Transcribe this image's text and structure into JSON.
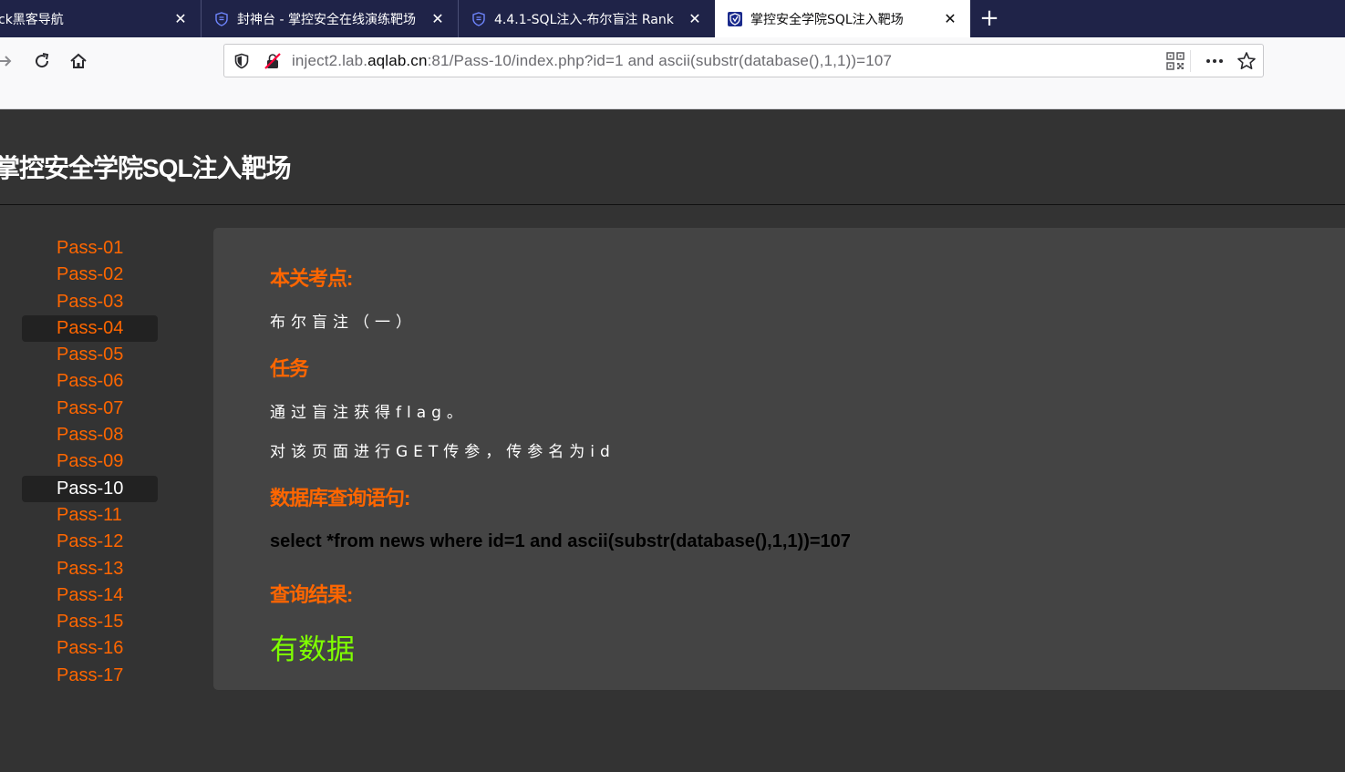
{
  "browser": {
    "tabs": [
      {
        "title": "ck黑客导航",
        "active": false
      },
      {
        "title": "封神台 - 掌控安全在线演练靶场",
        "active": false
      },
      {
        "title": "4.4.1-SQL注入-布尔盲注 Rank",
        "active": false
      },
      {
        "title": "掌控安全学院SQL注入靶场",
        "active": true
      }
    ],
    "url": {
      "prefix": "inject2.lab.",
      "domain": "aqlab.cn",
      "path": ":81/Pass-10/index.php?id=1 and ascii(substr(database(),1,1))=107"
    },
    "colors": {
      "tabbar": "#1f2348",
      "accent": "#ff6600"
    }
  },
  "site": {
    "title": "掌控安全学院SQL注入靶场"
  },
  "sidebar": {
    "items": [
      {
        "label": "Pass-01"
      },
      {
        "label": "Pass-02"
      },
      {
        "label": "Pass-03"
      },
      {
        "label": "Pass-04",
        "highlighted": true
      },
      {
        "label": "Pass-05"
      },
      {
        "label": "Pass-06"
      },
      {
        "label": "Pass-07"
      },
      {
        "label": "Pass-08"
      },
      {
        "label": "Pass-09"
      },
      {
        "label": "Pass-10",
        "highlighted": true,
        "current": true
      },
      {
        "label": "Pass-11"
      },
      {
        "label": "Pass-12"
      },
      {
        "label": "Pass-13"
      },
      {
        "label": "Pass-14"
      },
      {
        "label": "Pass-15"
      },
      {
        "label": "Pass-16"
      },
      {
        "label": "Pass-17"
      }
    ]
  },
  "content": {
    "point_heading": "本关考点:",
    "point_text": "布尔盲注（一）",
    "task_heading": "任务",
    "task_lines": [
      "通过盲注获得flag。",
      "对该页面进行GET传参，传参名为id"
    ],
    "query_heading": "数据库查询语句:",
    "query_sql": "select *from news where id=1 and ascii(substr(database(),1,1))=107",
    "result_heading": "查询结果:",
    "result_value": "有数据"
  }
}
